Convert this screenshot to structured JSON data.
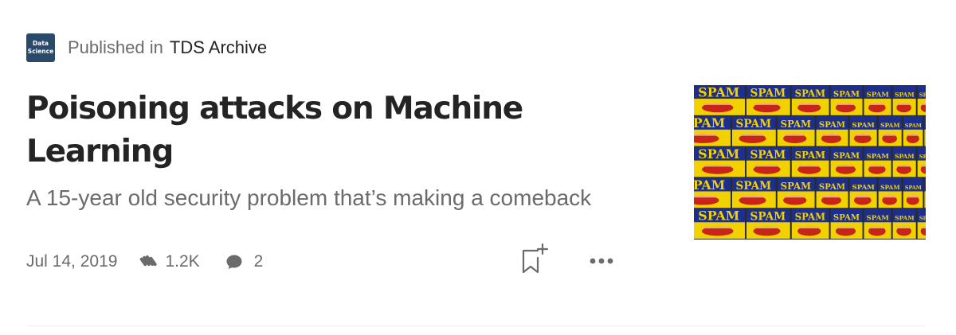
{
  "publication": {
    "logo_line1": "Data",
    "logo_line2": "Science",
    "prefix": "Published in",
    "name": "TDS Archive"
  },
  "article": {
    "title": "Poisoning attacks on Machine Learning",
    "subtitle": "A 15-year old security problem that’s making a comeback",
    "date": "Jul 14, 2019",
    "claps": "1.2K",
    "comments": "2"
  },
  "thumbnail": {
    "can_label": "SPAM",
    "colors": {
      "can_blue": "#1d2f8a",
      "can_yellow": "#f1d200",
      "can_red": "#c8241a",
      "background": "#2a2a20"
    }
  },
  "icons": {
    "clap": "clap-icon",
    "comment": "comment-icon",
    "bookmark": "bookmark-add-icon",
    "more": "more-horizontal-icon"
  }
}
